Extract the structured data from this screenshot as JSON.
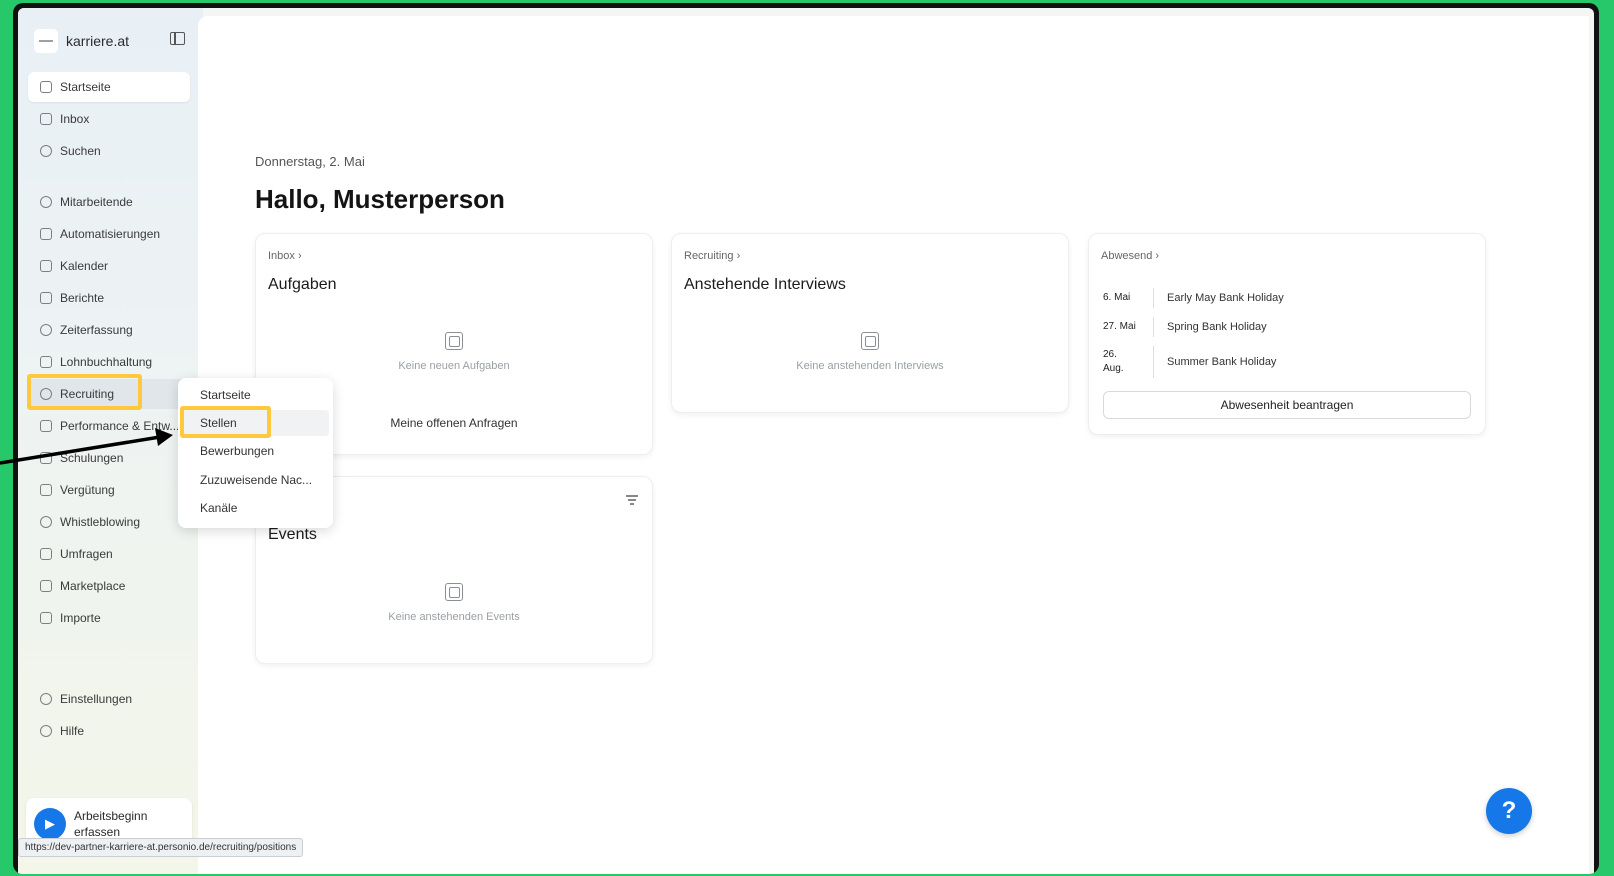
{
  "brand": {
    "name": "karriere.at"
  },
  "sidebar": {
    "items": [
      {
        "label": "Startseite",
        "icon": "home-icon"
      },
      {
        "label": "Inbox",
        "icon": "inbox-icon"
      },
      {
        "label": "Suchen",
        "icon": "search-icon"
      },
      {
        "label": "Mitarbeitende",
        "icon": "users-icon"
      },
      {
        "label": "Automatisierungen",
        "icon": "sparkle-icon"
      },
      {
        "label": "Kalender",
        "icon": "calendar-icon"
      },
      {
        "label": "Berichte",
        "icon": "report-icon"
      },
      {
        "label": "Zeiterfassung",
        "icon": "clock-icon"
      },
      {
        "label": "Lohnbuchhaltung",
        "icon": "payroll-icon"
      },
      {
        "label": "Recruiting",
        "icon": "globe-icon"
      },
      {
        "label": "Performance & Entw...",
        "icon": "chart-icon"
      },
      {
        "label": "Schulungen",
        "icon": "graduation-icon"
      },
      {
        "label": "Vergütung",
        "icon": "money-bag-icon"
      },
      {
        "label": "Whistleblowing",
        "icon": "shield-icon"
      },
      {
        "label": "Umfragen",
        "icon": "survey-icon"
      },
      {
        "label": "Marketplace",
        "icon": "grid-icon"
      },
      {
        "label": "Importe",
        "icon": "import-icon"
      },
      {
        "label": "Einstellungen",
        "icon": "gear-icon"
      },
      {
        "label": "Hilfe",
        "icon": "help-icon"
      }
    ],
    "work_start": "Arbeitsbeginn erfassen"
  },
  "status_url": "https://dev-partner-karriere-at.personio.de/recruiting/positions",
  "main": {
    "date": "Donnerstag, 2. Mai",
    "greeting": "Hallo, Musterperson"
  },
  "cards": {
    "tasks": {
      "crumb": "Inbox ›",
      "title": "Aufgaben",
      "empty": "Keine neuen Aufgaben",
      "link": "Meine offenen Anfragen"
    },
    "interviews": {
      "crumb": "Recruiting ›",
      "title": "Anstehende Interviews",
      "empty": "Keine anstehenden Interviews"
    },
    "absent": {
      "crumb": "Abwesend ›",
      "rows": [
        {
          "date": "6. Mai",
          "name": "Early May Bank Holiday"
        },
        {
          "date": "27. Mai",
          "name": "Spring Bank Holiday"
        },
        {
          "date": "26. Aug.",
          "name": "Summer Bank Holiday"
        }
      ],
      "button": "Abwesenheit beantragen"
    },
    "events": {
      "title": "Events",
      "empty": "Keine anstehenden Events"
    }
  },
  "dropdown": {
    "items": [
      "Startseite",
      "Stellen",
      "Bewerbungen",
      "Zuzuweisende Nac...",
      "Kanäle"
    ]
  },
  "help": {
    "label": "?"
  },
  "colors": {
    "highlight": "#ffc83d",
    "accent": "#1678e8",
    "frame": "#27c86a"
  }
}
